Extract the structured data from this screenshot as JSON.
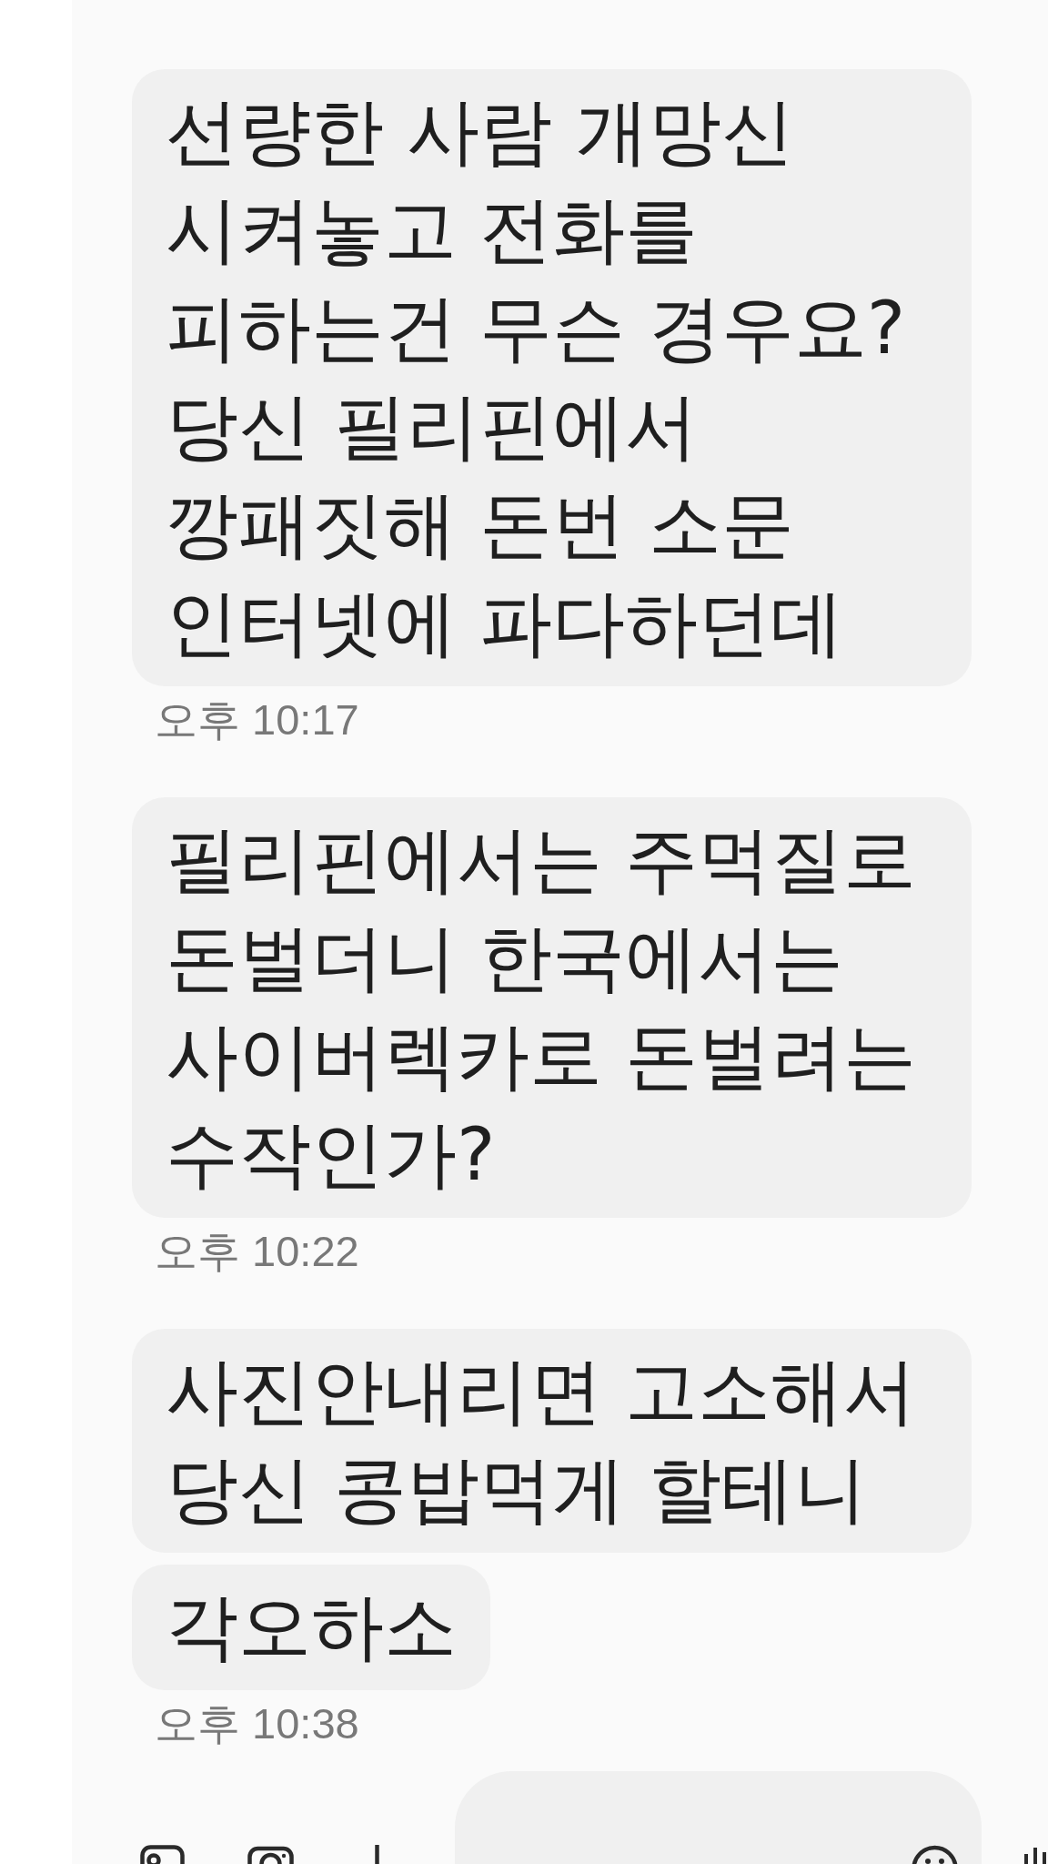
{
  "conversation": [
    {
      "bubbles": [
        "선량한 사람 개망신 시켜놓고 전화를 피하는건 무슨 경우요? 당신 필리핀에서 깡패짓해 돈번 소문 인터넷에 파다하던데"
      ],
      "time": "오후 10:17"
    },
    {
      "bubbles": [
        "필리핀에서는 주먹질로 돈벌더니 한국에서는 사이버렉카로 돈벌려는 수작인가?"
      ],
      "time": "오후 10:22"
    },
    {
      "bubbles": [
        "사진안내리면 고소해서 당신 콩밥먹게 할테니",
        "각오하소"
      ],
      "time": "오후 10:38"
    }
  ]
}
